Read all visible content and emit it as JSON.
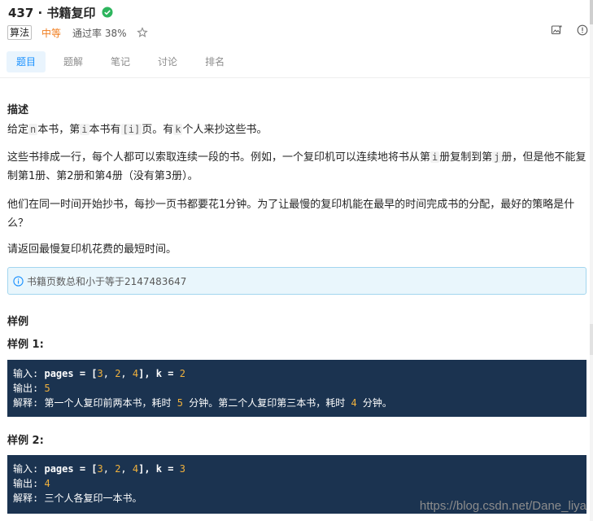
{
  "problem": {
    "title": "437 · 书籍复印",
    "tag": "算法",
    "difficulty": "中等",
    "pass_rate": "通过率 38%"
  },
  "tabs": [
    {
      "label": "题目"
    },
    {
      "label": "题解"
    },
    {
      "label": "笔记"
    },
    {
      "label": "讨论"
    },
    {
      "label": "排名"
    }
  ],
  "description": {
    "heading": "描述",
    "line1": {
      "t1": "给定",
      "c1": "n",
      "t2": "本书，第",
      "c2": "i",
      "t3": "本书有",
      "c3": "[i]",
      "t4": "页。有",
      "c4": "k",
      "t5": "个人来抄这些书。"
    },
    "para2": {
      "t1": "这些书排成一行，每个人都可以索取连续一段的书。例如，一个复印机可以连续地将书从第",
      "c1": "i",
      "t2": "册复制到第",
      "c2": "j",
      "t3": "册，但是他不能复制第1册、第2册和第4册（没有第3册）。"
    },
    "para3": "他们在同一时间开始抄书，每抄一页书都要花1分钟。为了让最慢的复印机能在最早的时间完成书的分配，最好的策略是什么？",
    "para4": "请返回最慢复印机花费的最短时间。"
  },
  "note": "书籍页数总和小于等于2147483647",
  "samples": {
    "heading": "样例",
    "sample1": {
      "heading": "样例 1:",
      "input_label": "输入:",
      "input_text": "pages = [",
      "v1": "3",
      "v2": "2",
      "v3": "4",
      "k_text": "], k = ",
      "k": "2",
      "output_label": "输出:",
      "output": "5",
      "explain_label": "解释:",
      "explain_a": "第一个人复印前两本书，耗时",
      "explain_n1": "5",
      "explain_b": "分钟。第二个人复印第三本书，耗时",
      "explain_n2": "4",
      "explain_c": "分钟。"
    },
    "sample2": {
      "heading": "样例 2:",
      "input_label": "输入:",
      "input_text": "pages = [",
      "v1": "3",
      "v2": "2",
      "v3": "4",
      "k_text": "], k = ",
      "k": "3",
      "output_label": "输出:",
      "output": "4",
      "explain_label": "解释:",
      "explain": "三个人各复印一本书。"
    }
  },
  "watermark": "https://blog.csdn.net/Dane_liya",
  "colors": {
    "accent": "#1890ff",
    "difficulty": "#f07c1c",
    "code_bg": "#1b3350",
    "code_number": "#f0b13d",
    "solved": "#2db55d"
  }
}
